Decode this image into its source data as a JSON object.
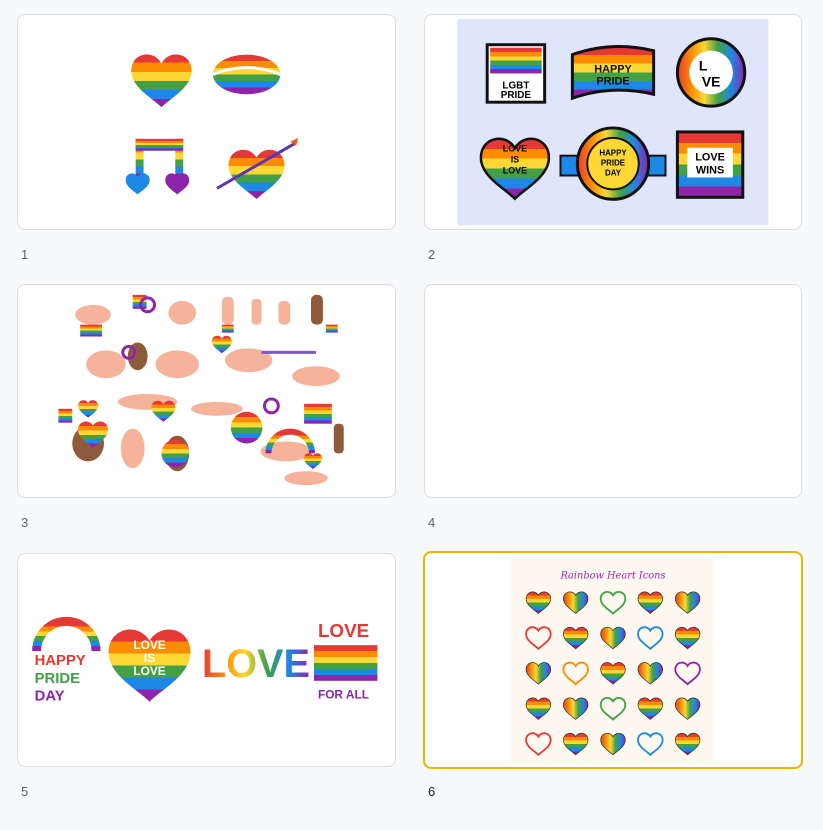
{
  "slides": [
    {
      "number": "1"
    },
    {
      "number": "2",
      "texts": [
        "LGBT",
        "PRIDE",
        "HAPPY",
        "PRIDE",
        "L",
        "VE",
        "LOVE",
        "IS",
        "LOVE",
        "HAPPY",
        "PRIDE",
        "DAY",
        "LOVE",
        "WINS"
      ]
    },
    {
      "number": "3"
    },
    {
      "number": "4"
    },
    {
      "number": "5",
      "texts": [
        "HAPPY",
        "PRIDE",
        "DAY",
        "LOVE",
        "IS",
        "LOVE",
        "LOVE",
        "LOVE",
        "FOR ALL"
      ]
    },
    {
      "number": "6",
      "title": "Rainbow Heart Icons"
    }
  ],
  "selected_slide": "6",
  "colors": {
    "selected_border": "#f0b400",
    "rainbow": [
      "#e53935",
      "#fb8c00",
      "#fdd835",
      "#43a047",
      "#1e88e5",
      "#8e24aa"
    ]
  }
}
